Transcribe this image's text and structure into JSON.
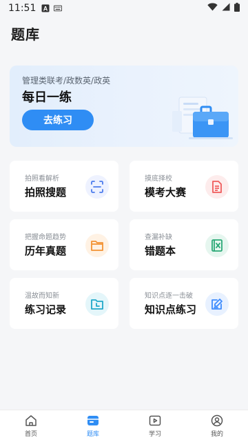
{
  "status_bar": {
    "time": "11:51"
  },
  "page": {
    "title": "题库"
  },
  "daily": {
    "subtitle": "管理类联考/政数英/政英",
    "title": "每日一练",
    "button_label": "去练习",
    "illustration_icon": "briefcase-illustration"
  },
  "tiles": [
    {
      "sub": "拍照看解析",
      "title": "拍照搜题",
      "icon": "scan-icon",
      "color": "#4b7bec",
      "bg": "#eef2ff"
    },
    {
      "sub": "摸底择校",
      "title": "模考大赛",
      "icon": "document-icon",
      "color": "#ef5b5b",
      "bg": "#fdecec"
    },
    {
      "sub": "把握命题趋势",
      "title": "历年真题",
      "icon": "folder-icon",
      "color": "#f39233",
      "bg": "#fff2e4"
    },
    {
      "sub": "查漏补缺",
      "title": "错题本",
      "icon": "error-book-icon",
      "color": "#2aa876",
      "bg": "#e6f6ef"
    },
    {
      "sub": "温故而知新",
      "title": "练习记录",
      "icon": "history-icon",
      "color": "#1fa8c9",
      "bg": "#e4f6fa"
    },
    {
      "sub": "知识点逐一击破",
      "title": "知识点练习",
      "icon": "edit-icon",
      "color": "#3d8bfd",
      "bg": "#e8f1ff"
    }
  ],
  "tabbar": [
    {
      "label": "首页",
      "icon": "home-icon"
    },
    {
      "label": "题库",
      "icon": "question-bank-icon"
    },
    {
      "label": "学习",
      "icon": "play-icon"
    },
    {
      "label": "我的",
      "icon": "profile-icon"
    }
  ],
  "colors": {
    "accent": "#2f8df4",
    "background": "#f5f6f8"
  }
}
